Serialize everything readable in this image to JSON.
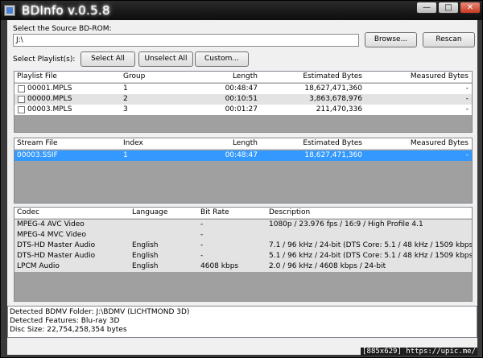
{
  "window": {
    "title": "BDInfo v.0.5.8"
  },
  "titlebar": {
    "minimize": "—",
    "maximize": "□",
    "close": "✕"
  },
  "source": {
    "label": "Select the Source BD-ROM:",
    "path": "J:\\",
    "browse": "Browse...",
    "rescan": "Rescan"
  },
  "playlist_toolbar": {
    "label": "Select Playlist(s):",
    "select_all": "Select All",
    "unselect_all": "Unselect All",
    "custom": "Custom..."
  },
  "playlists": {
    "headers": [
      "Playlist File",
      "Group",
      "Length",
      "Estimated Bytes",
      "Measured Bytes"
    ],
    "rows": [
      [
        "00001.MPLS",
        "1",
        "00:48:47",
        "18,627,471,360",
        "-"
      ],
      [
        "00000.MPLS",
        "2",
        "00:10:51",
        "3,863,678,976",
        "-"
      ],
      [
        "00003.MPLS",
        "3",
        "00:01:27",
        "211,470,336",
        "-"
      ]
    ]
  },
  "streams": {
    "headers": [
      "Stream File",
      "Index",
      "Length",
      "Estimated Bytes",
      "Measured Bytes"
    ],
    "rows": [
      [
        "00003.SSIF",
        "1",
        "00:48:47",
        "18,627,471,360",
        "-"
      ]
    ]
  },
  "codecs": {
    "headers": [
      "Codec",
      "Language",
      "Bit Rate",
      "Description"
    ],
    "rows": [
      [
        "MPEG-4 AVC Video",
        "",
        "-",
        "1080p / 23.976 fps / 16:9 / High Profile 4.1"
      ],
      [
        "MPEG-4 MVC Video",
        "",
        "-",
        ""
      ],
      [
        "DTS-HD Master Audio",
        "English",
        "-",
        "7.1 / 96 kHz / 24-bit (DTS Core: 5.1 / 48 kHz / 1509 kbps / 24-bit)"
      ],
      [
        "DTS-HD Master Audio",
        "English",
        "-",
        "5.1 / 96 kHz / 24-bit (DTS Core: 5.1 / 48 kHz / 1509 kbps / 24-bit)"
      ],
      [
        "LPCM Audio",
        "English",
        "4608 kbps",
        "2.0 / 96 kHz / 4608 kbps / 24-bit"
      ]
    ]
  },
  "status": {
    "lines": [
      "Detected BDMV Folder: J:\\BDMV (LICHTMOND 3D)",
      "Detected Features: Blu-ray 3D",
      "Disc Size: 22,754,258,354 bytes"
    ]
  },
  "overlay": {
    "watermark": "[885x629] https://upic.me/"
  }
}
